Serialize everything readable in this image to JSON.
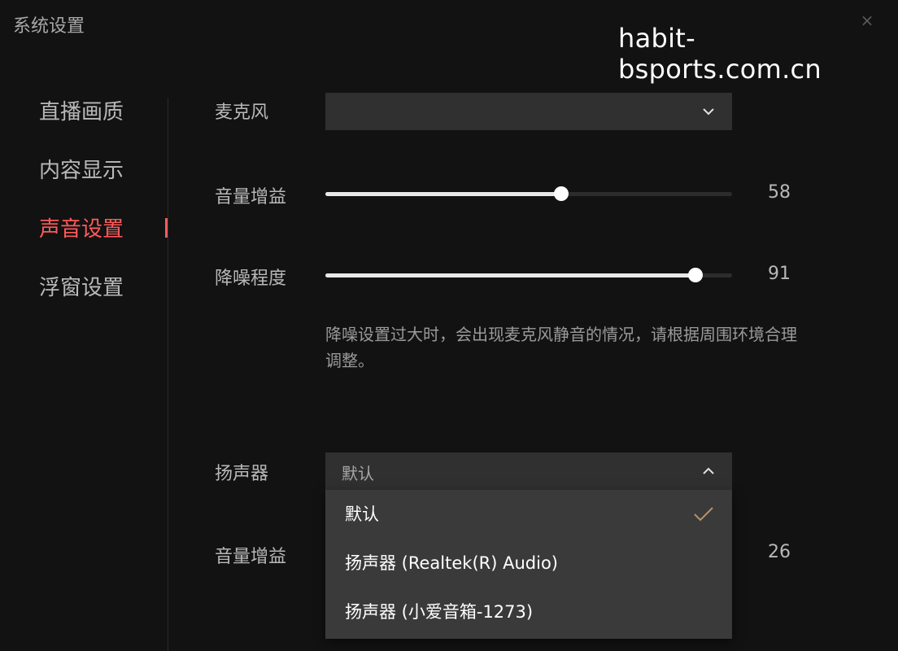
{
  "window": {
    "title": "系统设置",
    "close_icon": "close-icon"
  },
  "watermark": "habit-bsports.com.cn",
  "sidebar": {
    "items": [
      {
        "label": "直播画质"
      },
      {
        "label": "内容显示"
      },
      {
        "label": "声音设置",
        "active": true
      },
      {
        "label": "浮窗设置"
      }
    ],
    "active_color": "#ff5a5a"
  },
  "microphone": {
    "label": "麦克风",
    "value": "",
    "icon": "chevron-down-icon"
  },
  "mic_gain": {
    "label": "音量增益",
    "value": "58",
    "level": 58
  },
  "noise": {
    "label": "降噪程度",
    "value": "91",
    "level": 91
  },
  "hint": "降噪设置过大时，会出现麦克风静音的情况，请根据周围环境合理调整。",
  "speaker": {
    "label": "扬声器",
    "value": "默认",
    "icon": "chevron-up-icon",
    "options": [
      {
        "label": "默认",
        "selected": true
      },
      {
        "label": "扬声器 (Realtek(R) Audio)"
      },
      {
        "label": "扬声器 (小爱音箱-1273)"
      }
    ]
  },
  "speaker_gain": {
    "label": "音量增益",
    "value": "26"
  }
}
